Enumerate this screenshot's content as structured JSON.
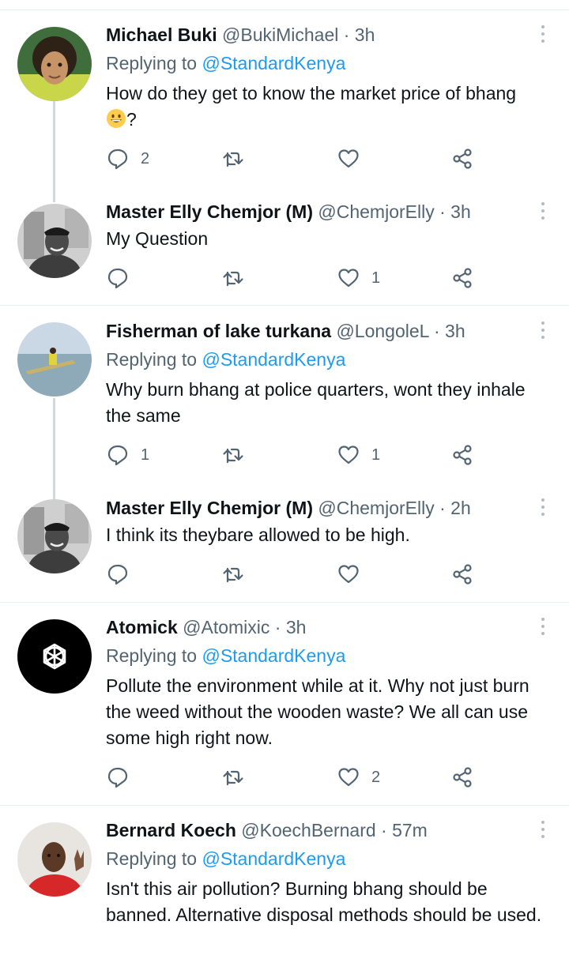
{
  "replying_label": "Replying to ",
  "tweets": [
    {
      "name": "Michael Buki",
      "handle": "@BukiMichael",
      "time": "· 3h",
      "replying_to": "@StandardKenya",
      "text": "How do they get to know the market price of bhang",
      "text_suffix": "?",
      "emoji": "grinning-face-emoji",
      "reply_count": "2",
      "retweet_count": "",
      "like_count": ""
    },
    {
      "name": "Master Elly Chemjor (M)",
      "handle": "@ChemjorElly",
      "time": "· 3h",
      "text": "My Question",
      "reply_count": "",
      "retweet_count": "",
      "like_count": "1"
    },
    {
      "name": "Fisherman of lake turkana",
      "handle": "@LongoleL",
      "time": "· 3h",
      "replying_to": "@StandardKenya",
      "text": "Why burn bhang at police quarters, wont they inhale the same",
      "reply_count": "1",
      "retweet_count": "",
      "like_count": "1"
    },
    {
      "name": "Master Elly Chemjor (M)",
      "handle": "@ChemjorElly",
      "time": "· 2h",
      "text": "I think its theybare allowed to be high.",
      "reply_count": "",
      "retweet_count": "",
      "like_count": ""
    },
    {
      "name": "Atomick",
      "handle": "@Atomixic",
      "time": "· 3h",
      "replying_to": "@StandardKenya",
      "text": "Pollute the environment while at it. Why not just burn the weed without the wooden waste? We all can use some high right now.",
      "reply_count": "",
      "retweet_count": "",
      "like_count": "2"
    },
    {
      "name": "Bernard Koech",
      "handle": "@KoechBernard",
      "time": "· 57m",
      "replying_to": "@StandardKenya",
      "text": "Isn't this air pollution? Burning bhang should be banned. Alternative disposal methods should be used.",
      "reply_count": "",
      "retweet_count": "",
      "like_count": ""
    }
  ],
  "icons": {
    "reply": "reply-icon",
    "retweet": "retweet-icon",
    "like": "like-icon",
    "share": "share-icon",
    "more": "more-options-icon"
  },
  "colors": {
    "link": "#1d9bf0",
    "secondary_text": "#536471",
    "divider": "#e6ecf0",
    "thread_line": "#cfd9de"
  }
}
